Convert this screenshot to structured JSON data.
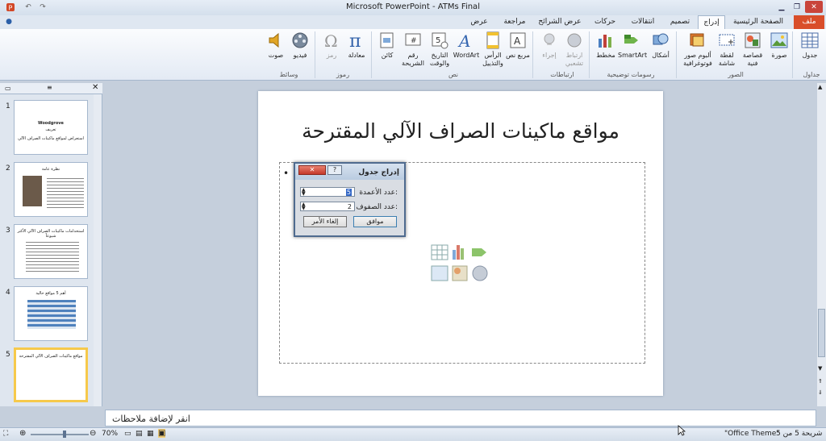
{
  "window": {
    "title": "Microsoft PowerPoint - ATMs Final"
  },
  "tabs": [
    {
      "label": "ملف",
      "key": "file"
    },
    {
      "label": "الصفحة الرئيسية",
      "key": "home"
    },
    {
      "label": "إدراج",
      "key": "insert",
      "active": true
    },
    {
      "label": "تصميم",
      "key": "design"
    },
    {
      "label": "انتقالات",
      "key": "transitions"
    },
    {
      "label": "حركات",
      "key": "animations"
    },
    {
      "label": "عرض الشرائح",
      "key": "slideshow"
    },
    {
      "label": "مراجعة",
      "key": "review"
    },
    {
      "label": "عرض",
      "key": "view"
    }
  ],
  "ribbon": {
    "groups": {
      "tables": "جداول",
      "images": "الصور",
      "illustrations": "رسومات توضيحية",
      "links": "ارتباطات",
      "text": "نص",
      "symbols": "رموز",
      "media": "وسائط"
    },
    "buttons": {
      "table": "جدول",
      "picture": "صورة",
      "clipart": "قصاصة فنية",
      "screenshot": "لقطة شاشة",
      "photo_album": "ألبوم صور فوتوغرافية",
      "shapes": "أشكال",
      "smartart": "SmartArt",
      "chart": "مخطط",
      "hyperlink": "ارتباط تشعبي",
      "action": "إجراء",
      "textbox": "مربع نص",
      "header_footer": "الرأس والتذييل",
      "wordart": "WordArt",
      "date_time": "التاريخ والوقت",
      "slide_number": "رقم الشريحة",
      "object": "كائن",
      "equation": "معادلة",
      "symbol": "رمز",
      "video": "فيديو",
      "audio": "صوت"
    }
  },
  "slides": [
    {
      "num": "1",
      "title": "Woodgrove",
      "lines": [
        "تعريف",
        "استعراض لمواقع ماكينات الصراف الآلي"
      ]
    },
    {
      "num": "2",
      "title": "نظرة عامة",
      "lines": [
        "...",
        "..."
      ]
    },
    {
      "num": "3",
      "title": "استخدامات ماكينات الصراف الآلي الأكثر شيوعاً",
      "lines": [
        "..."
      ]
    },
    {
      "num": "4",
      "title": "أهم 5 مواقع حالية",
      "lines": [
        "..."
      ]
    },
    {
      "num": "5",
      "title": "مواقع ماكينات الصراف الآلي المقترحة",
      "lines": []
    }
  ],
  "slide": {
    "title": "مواقع ماكينات الصراف الآلي المقترحة",
    "bullet": "•"
  },
  "dialog": {
    "title": "إدراج جدول",
    "columns_label": "عدد الأعمدة:",
    "columns_value": "5",
    "rows_label": "عدد الصفوف:",
    "rows_value": "2",
    "ok": "موافق",
    "cancel": "إلغاء الأمر",
    "help": "?",
    "close": "✕"
  },
  "notes": {
    "placeholder": "انقر لإضافة ملاحظات"
  },
  "status": {
    "slide_info": "شريحة 5 من 5",
    "theme": "\"Office Theme\"",
    "zoom": "70%"
  },
  "colors": {
    "accent": "#d94e2a",
    "selected_thumb": "#f6c94b"
  }
}
